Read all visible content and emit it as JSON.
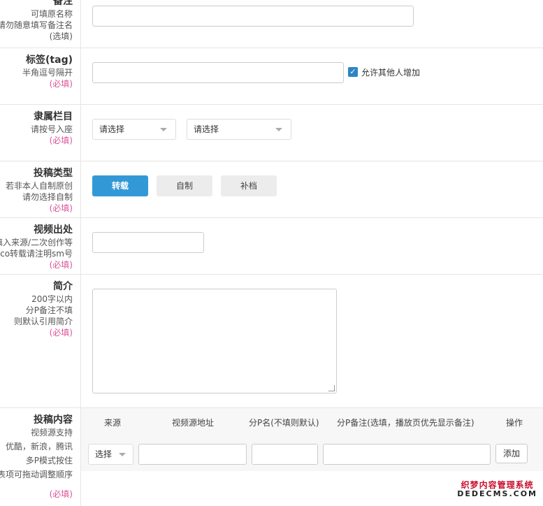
{
  "rows": {
    "remark": {
      "title": "备注",
      "sub1": "可填原名称",
      "sub2": "请勿随意填写备注名",
      "req": "(选填)"
    },
    "tag": {
      "title": "标签(tag)",
      "sub1": "半角逗号隔开",
      "req": "(必填)",
      "checkbox_label": "允许其他人增加",
      "checkbox_checked": true
    },
    "category": {
      "title": "隶属栏目",
      "sub1": "请按号入座",
      "req": "(必填)",
      "select1": "请选择",
      "select2": "请选择"
    },
    "type": {
      "title": "投稿类型",
      "sub1": "若非本人自制原创",
      "sub2": "请勿选择自制",
      "req": "(必填)",
      "options": [
        "转载",
        "自制",
        "补档"
      ],
      "selected": "转载"
    },
    "source": {
      "title": "视频出处",
      "sub1": "填入来源/二次创作等",
      "sub2": "nico转载请注明sm号",
      "req": "(必填)"
    },
    "intro": {
      "title": "简介",
      "sub1": "200字以内",
      "sub2": "分P备注不填",
      "sub3": "则默认引用简介",
      "req": "(必填)"
    },
    "content": {
      "title": "投稿内容",
      "sub1": "视频源支持",
      "sub2": "优酷，新浪，腾讯",
      "sub3": "多P模式按住",
      "sub4": "表项可拖动调整顺序",
      "req": "(必填)",
      "headers": [
        "来源",
        "视频源地址",
        "分P名(不填则默认)",
        "分P备注(选填，播放页优先显示备注)",
        "操作"
      ],
      "source_select": "选择",
      "add_button": "添加"
    }
  },
  "watermark": {
    "line1": "织梦内容管理系统",
    "line2": "DEDECMS.COM"
  },
  "colors": {
    "accent": "#3399d6",
    "required": "#d9539a",
    "checkbox": "#2e84c4"
  }
}
